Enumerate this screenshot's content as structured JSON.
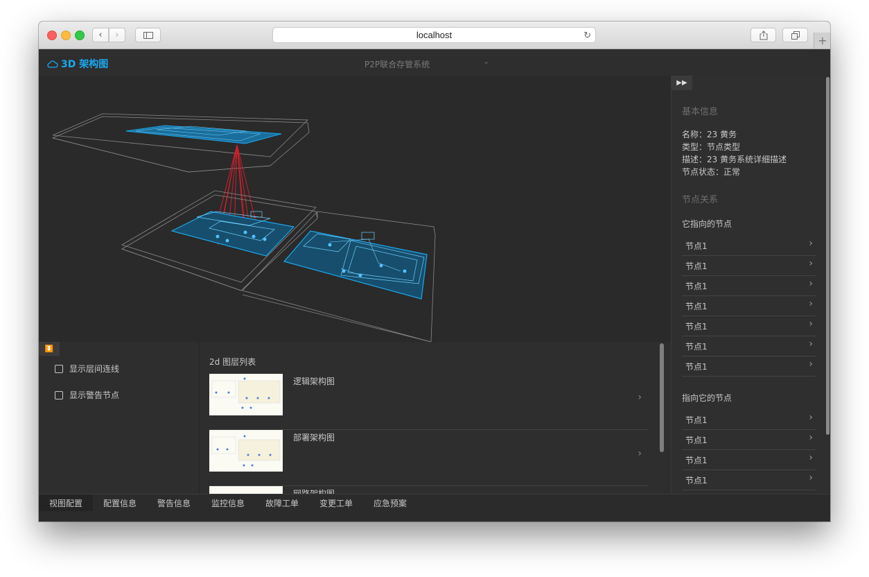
{
  "browser": {
    "url": "localhost"
  },
  "app": {
    "title": "3D 架构图",
    "system_selected": "P2P联合存管系统"
  },
  "right_panel": {
    "basic_info_title": "基本信息",
    "name_line": "名称：23 黄务",
    "type_line": "类型：节点类型",
    "desc_line": "描述：23 黄务系统详细描述",
    "status_line": "节点状态：正常",
    "relation_title": "节点关系",
    "outgoing_title": "它指向的节点",
    "outgoing": [
      "节点1",
      "节点1",
      "节点1",
      "节点1",
      "节点1",
      "节点1",
      "节点1"
    ],
    "incoming_title": "指向它的节点",
    "incoming": [
      "节点1",
      "节点1",
      "节点1",
      "节点1"
    ]
  },
  "options": {
    "show_layer_links": "显示层间连线",
    "show_alert_nodes": "显示警告节点"
  },
  "layers": {
    "title": "2d 图层列表",
    "items": [
      {
        "name": "逻辑架构图"
      },
      {
        "name": "部署架构图"
      },
      {
        "name": "网路架构图"
      }
    ]
  },
  "tabs": [
    "视图配置",
    "配置信息",
    "警告信息",
    "监控信息",
    "故障工单",
    "变更工单",
    "应急预案"
  ],
  "colors": {
    "accent": "#1ba8f0",
    "link_lines": "#d11f2c",
    "panel_bg": "#2e2e2e"
  }
}
